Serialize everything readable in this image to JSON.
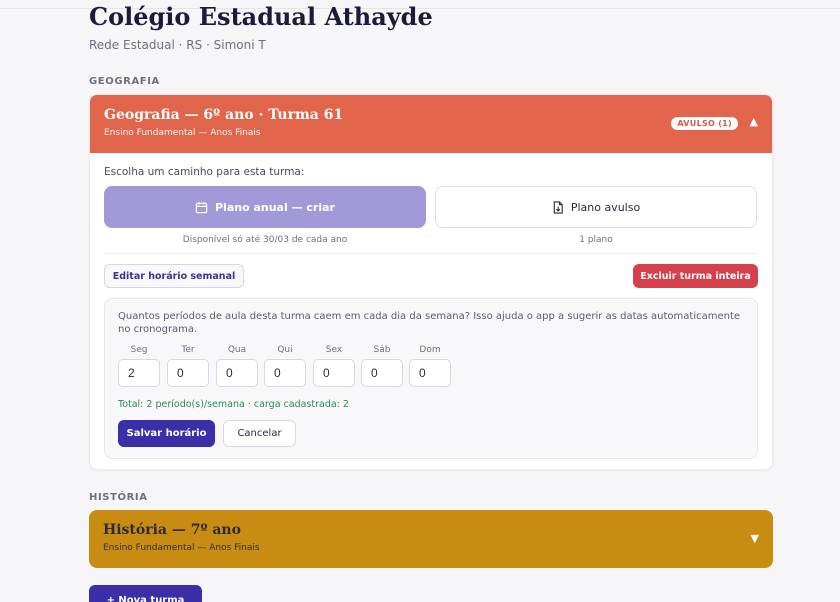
{
  "header": {
    "title": "Colégio Estadual Athayde",
    "subtitle": "Rede Estadual · RS · Simoni T"
  },
  "sections": {
    "geografia": {
      "label": "GEOGRAFIA",
      "card": {
        "title": "Geografia — 6º ano · Turma 61",
        "subtitle": "Ensino Fundamental — Anos Finais",
        "badge": "AVULSO (1)",
        "expanded": true,
        "header_color": "#e0654b",
        "prompt": "Escolha um caminho para esta turma:",
        "plan_annual": {
          "label": "Plano anual — criar",
          "icon": "calendar-icon",
          "note": "Disponível só até 30/03 de cada ano"
        },
        "plan_single": {
          "label": "Plano avulso",
          "icon": "file-download-icon",
          "note": "1 plano"
        },
        "edit_schedule_label": "Editar horário semanal",
        "delete_class_label": "Excluir turma inteira",
        "schedule": {
          "help": "Quantos períodos de aula desta turma caem em cada dia da semana? Isso ajuda o app a sugerir as datas automaticamente no cronograma.",
          "days": [
            {
              "label": "Seg",
              "value": "2"
            },
            {
              "label": "Ter",
              "value": "0"
            },
            {
              "label": "Qua",
              "value": "0"
            },
            {
              "label": "Qui",
              "value": "0"
            },
            {
              "label": "Sex",
              "value": "0"
            },
            {
              "label": "Sáb",
              "value": "0"
            },
            {
              "label": "Dom",
              "value": "0"
            }
          ],
          "total": "Total: 2 período(s)/semana · carga cadastrada: 2",
          "save_label": "Salvar horário",
          "cancel_label": "Cancelar"
        }
      }
    },
    "historia": {
      "label": "HISTÓRIA",
      "card": {
        "title": "História — 7º ano",
        "subtitle": "Ensino Fundamental — Anos Finais",
        "expanded": false,
        "header_color": "#c98c12"
      }
    }
  },
  "new_class_label": "+ Nova turma",
  "colors": {
    "accent": "#3b2fa8",
    "danger": "#d6404d",
    "success": "#2f8a4f"
  }
}
